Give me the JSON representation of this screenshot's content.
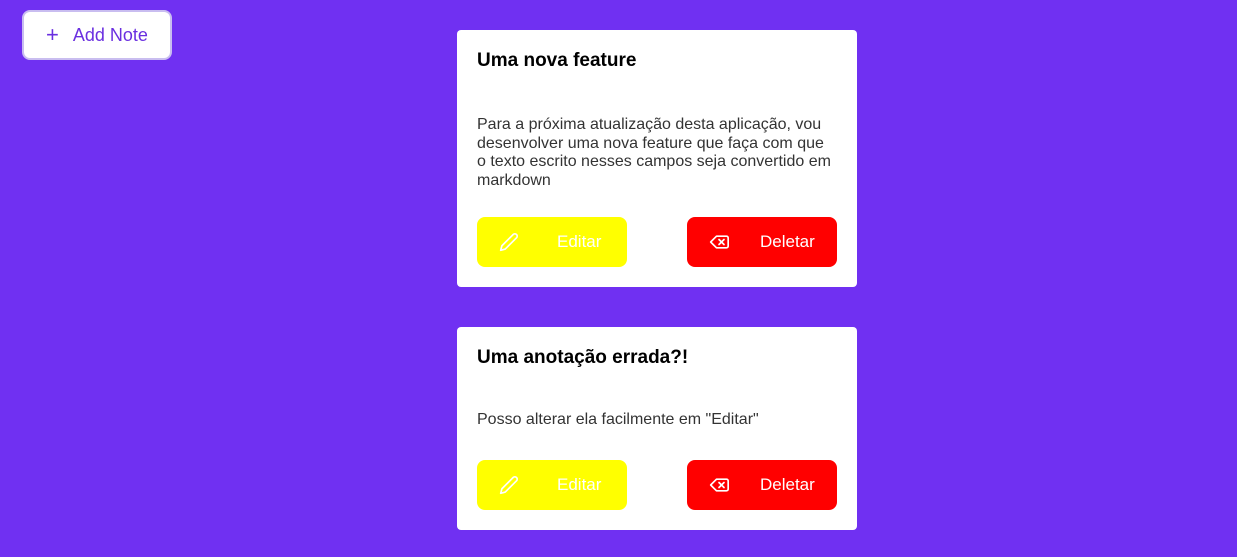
{
  "add_note": {
    "icon": "plus-icon",
    "label": "Add Note"
  },
  "notes": [
    {
      "title": "Uma nova feature",
      "body": "Para a próxima atualização desta aplicação, vou desenvolver uma nova feature que faça com que o texto escrito nesses campos seja convertido em markdown",
      "edit_label": "Editar",
      "edit_icon": "pencil-icon",
      "delete_label": "Deletar",
      "delete_icon": "backspace-icon"
    },
    {
      "title": "Uma anotação errada?!",
      "body": "Posso alterar ela facilmente em \"Editar\"",
      "edit_label": "Editar",
      "edit_icon": "pencil-icon",
      "delete_label": "Deletar",
      "delete_icon": "backspace-icon"
    }
  ],
  "colors": {
    "background": "#7030F2",
    "edit_button": "#FFFF00",
    "delete_button": "#FF0000",
    "accent_text": "#6A2FE0"
  }
}
